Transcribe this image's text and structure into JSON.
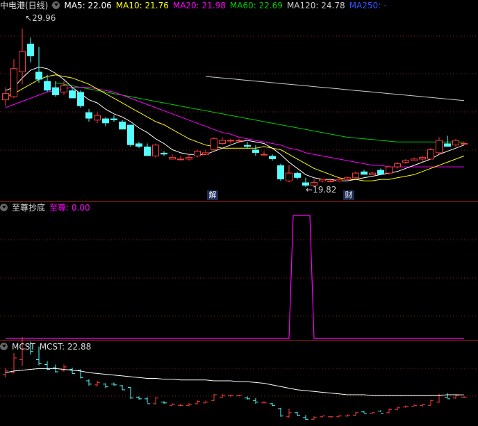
{
  "main": {
    "title": "中电港(日线)",
    "ma": [
      {
        "label": "MA5: 22.06",
        "color": "#ffffff"
      },
      {
        "label": "MA10: 21.76",
        "color": "#ffff00"
      },
      {
        "label": "MA20: 21.98",
        "color": "#ff00ff"
      },
      {
        "label": "MA60: 22.69",
        "color": "#00cc00"
      },
      {
        "label": "MA120: 24.78",
        "color": "#cccccc"
      },
      {
        "label": "MA250: -",
        "color": "#3355ff"
      }
    ],
    "high_label": "29.96",
    "low_label": "19.82",
    "marker_jie": "解",
    "marker_cai": "财"
  },
  "sub1": {
    "title": "至尊抄底",
    "value_label": "至尊: 0.00",
    "value_color": "#ff00ff"
  },
  "sub2": {
    "title": "MCST",
    "value_label": "MCST: 22.88"
  },
  "colors": {
    "up": "#ff3c3c",
    "down": "#54ffff",
    "grid": "#8a1e1e",
    "border": "#b02020",
    "ma5": "#ffffff",
    "ma10": "#ffff00",
    "ma20": "#ff00ff",
    "ma60": "#00cc00",
    "ma120": "#cccccc"
  },
  "chart_data": [
    {
      "type": "candlestick",
      "title": "中电港(日线)",
      "ylim": [
        19.5,
        31
      ],
      "candles": [
        [
          25.4,
          26.2,
          25.0,
          25.8
        ],
        [
          25.6,
          28.0,
          25.5,
          27.4
        ],
        [
          27.2,
          29.96,
          26.4,
          28.5
        ],
        [
          29.0,
          29.4,
          27.8,
          28.2
        ],
        [
          27.2,
          28.8,
          26.5,
          26.7
        ],
        [
          26.6,
          27.0,
          25.9,
          26.0
        ],
        [
          26.2,
          26.6,
          25.6,
          25.7
        ],
        [
          25.9,
          26.6,
          25.7,
          26.3
        ],
        [
          26.0,
          26.2,
          25.5,
          25.5
        ],
        [
          25.9,
          26.0,
          24.9,
          25.0
        ],
        [
          24.6,
          24.8,
          24.0,
          24.2
        ],
        [
          24.1,
          24.6,
          23.9,
          24.4
        ],
        [
          24.2,
          24.3,
          23.7,
          23.9
        ],
        [
          24.2,
          24.4,
          24.0,
          24.1
        ],
        [
          24.0,
          24.1,
          23.5,
          23.5
        ],
        [
          23.8,
          23.8,
          22.4,
          22.5
        ],
        [
          22.6,
          22.7,
          22.3,
          22.4
        ],
        [
          22.4,
          22.6,
          21.9,
          21.8
        ],
        [
          21.8,
          22.6,
          21.7,
          22.5
        ],
        [
          22.0,
          22.1,
          21.8,
          21.9
        ],
        [
          21.6,
          21.9,
          21.6,
          21.7
        ],
        [
          21.6,
          21.8,
          21.5,
          21.6
        ],
        [
          21.6,
          21.9,
          21.5,
          21.7
        ],
        [
          21.8,
          22.2,
          21.7,
          22.1
        ],
        [
          21.9,
          22.2,
          21.9,
          22.0
        ],
        [
          22.2,
          23.0,
          22.1,
          22.9
        ],
        [
          22.6,
          23.0,
          22.5,
          22.8
        ],
        [
          22.8,
          22.9,
          22.6,
          22.8
        ],
        [
          22.8,
          22.9,
          22.7,
          22.8
        ],
        [
          22.5,
          22.7,
          22.3,
          22.4
        ],
        [
          22.2,
          22.5,
          21.8,
          22.0
        ],
        [
          21.9,
          22.1,
          21.9,
          21.9
        ],
        [
          21.8,
          21.9,
          21.5,
          21.6
        ],
        [
          21.2,
          21.3,
          20.2,
          20.3
        ],
        [
          20.2,
          21.2,
          20.1,
          20.7
        ],
        [
          20.7,
          20.8,
          20.3,
          20.4
        ],
        [
          20.1,
          20.4,
          19.82,
          19.9
        ],
        [
          19.9,
          20.3,
          19.85,
          20.1
        ],
        [
          20.2,
          20.3,
          20.1,
          20.3
        ],
        [
          20.2,
          20.3,
          20.1,
          20.2
        ],
        [
          20.2,
          20.4,
          20.2,
          20.3
        ],
        [
          20.3,
          20.5,
          20.2,
          20.4
        ],
        [
          20.4,
          20.8,
          20.3,
          20.7
        ],
        [
          20.8,
          20.9,
          20.7,
          20.6
        ],
        [
          20.6,
          20.8,
          20.6,
          20.7
        ],
        [
          20.9,
          21.0,
          20.8,
          20.6
        ],
        [
          20.7,
          21.2,
          20.6,
          21.1
        ],
        [
          21.1,
          21.4,
          21.0,
          21.3
        ],
        [
          21.4,
          21.6,
          21.3,
          21.5
        ],
        [
          21.5,
          21.7,
          21.5,
          21.6
        ],
        [
          21.6,
          21.8,
          21.4,
          21.7
        ],
        [
          21.6,
          22.3,
          21.6,
          22.2
        ],
        [
          22.0,
          23.0,
          21.9,
          22.8
        ],
        [
          22.6,
          23.1,
          22.5,
          22.4
        ],
        [
          22.5,
          22.9,
          22.4,
          22.8
        ],
        [
          22.6,
          22.7,
          22.5,
          22.6
        ]
      ],
      "ma5": [
        26.0,
        26.2,
        26.8,
        27.3,
        27.5,
        27.4,
        27.1,
        26.7,
        26.2,
        25.8,
        25.4,
        25.2,
        24.8,
        24.5,
        24.3,
        24.0,
        23.6,
        23.3,
        22.9,
        22.6,
        22.2,
        22.0,
        21.9,
        21.9,
        21.9,
        22.1,
        22.3,
        22.5,
        22.7,
        22.8,
        22.7,
        22.6,
        22.3,
        21.9,
        21.4,
        21.0,
        20.6,
        20.4,
        20.3,
        20.3,
        20.2,
        20.2,
        20.3,
        20.4,
        20.5,
        20.6,
        20.7,
        20.8,
        21.0,
        21.2,
        21.4,
        21.6,
        21.9,
        22.1,
        22.3,
        22.5
      ],
      "ma10": [
        25.6,
        25.8,
        26.1,
        26.4,
        26.7,
        26.9,
        27.0,
        26.9,
        26.8,
        26.6,
        26.4,
        26.1,
        25.8,
        25.5,
        25.2,
        24.9,
        24.6,
        24.3,
        24.0,
        23.8,
        23.5,
        23.2,
        22.9,
        22.7,
        22.5,
        22.4,
        22.3,
        22.3,
        22.3,
        22.3,
        22.3,
        22.4,
        22.3,
        22.2,
        21.9,
        21.6,
        21.3,
        21.0,
        20.8,
        20.6,
        20.4,
        20.3,
        20.3,
        20.2,
        20.2,
        20.3,
        20.3,
        20.4,
        20.5,
        20.6,
        20.8,
        21.0,
        21.2,
        21.4,
        21.6,
        21.8
      ],
      "ma20": [
        24.9,
        25.1,
        25.3,
        25.5,
        25.7,
        25.9,
        26.0,
        26.1,
        26.2,
        26.2,
        26.2,
        26.1,
        26.0,
        25.9,
        25.7,
        25.5,
        25.3,
        25.1,
        24.9,
        24.7,
        24.5,
        24.3,
        24.1,
        23.9,
        23.7,
        23.5,
        23.3,
        23.2,
        23.0,
        22.9,
        22.8,
        22.7,
        22.6,
        22.5,
        22.3,
        22.2,
        22.0,
        21.9,
        21.8,
        21.7,
        21.6,
        21.5,
        21.4,
        21.3,
        21.2,
        21.2,
        21.1,
        21.1,
        21.1,
        21.1,
        21.1,
        21.1,
        21.1,
        21.1,
        21.1,
        21.1
      ],
      "ma60": [
        null,
        null,
        null,
        null,
        null,
        null,
        26.5,
        26.4,
        26.3,
        26.2,
        26.1,
        26.0,
        25.9,
        25.8,
        25.7,
        25.6,
        25.5,
        25.4,
        25.3,
        25.2,
        25.1,
        25.0,
        24.9,
        24.8,
        24.7,
        24.6,
        24.5,
        24.4,
        24.3,
        24.2,
        24.1,
        24.0,
        23.9,
        23.8,
        23.7,
        23.6,
        23.5,
        23.4,
        23.3,
        23.2,
        23.1,
        23.0,
        22.95,
        22.9,
        22.85,
        22.8,
        22.75,
        22.7,
        22.7,
        22.7,
        22.7,
        22.7,
        22.7,
        22.7,
        22.7,
        22.69
      ],
      "ma120": [
        null,
        null,
        null,
        null,
        null,
        null,
        null,
        null,
        null,
        null,
        null,
        null,
        null,
        null,
        null,
        null,
        null,
        null,
        null,
        null,
        null,
        null,
        null,
        null,
        26.9,
        26.85,
        26.8,
        26.75,
        26.7,
        26.65,
        26.6,
        26.55,
        26.5,
        26.45,
        26.4,
        26.35,
        26.3,
        26.25,
        26.2,
        26.15,
        26.1,
        26.05,
        26.0,
        25.95,
        25.9,
        25.85,
        25.8,
        25.75,
        25.7,
        25.65,
        25.6,
        25.55,
        25.5,
        25.45,
        25.4,
        25.35
      ]
    },
    {
      "type": "line",
      "title": "至尊抄底",
      "values": [
        0,
        0,
        0,
        0,
        0,
        0,
        0,
        0,
        0,
        0,
        0,
        0,
        0,
        0,
        0,
        0,
        0,
        0,
        0,
        0,
        0,
        0,
        0,
        0,
        0,
        0,
        0,
        0,
        0,
        0,
        0,
        0,
        0,
        0,
        0,
        1,
        1,
        0,
        0,
        0,
        0,
        0,
        0,
        0,
        0,
        0,
        0,
        0,
        0,
        0,
        0,
        0,
        0,
        0,
        0,
        0
      ],
      "ylim": [
        0,
        1
      ]
    },
    {
      "type": "line",
      "title": "MCST",
      "values": [
        25.6,
        25.8,
        25.9,
        26.0,
        26.1,
        26.1,
        26.1,
        26.0,
        25.9,
        25.8,
        25.6,
        25.5,
        25.4,
        25.3,
        25.2,
        25.1,
        25.0,
        24.9,
        24.9,
        24.8,
        24.8,
        24.7,
        24.7,
        24.7,
        24.7,
        24.6,
        24.6,
        24.6,
        24.5,
        24.5,
        24.4,
        24.3,
        24.1,
        23.9,
        23.7,
        23.5,
        23.4,
        23.3,
        23.2,
        23.1,
        23.0,
        22.9,
        22.9,
        22.9,
        22.8,
        22.8,
        22.8,
        22.8,
        22.8,
        22.8,
        22.8,
        22.8,
        22.8,
        22.9,
        22.9,
        22.88
      ],
      "ylim": [
        19.5,
        28
      ]
    }
  ]
}
